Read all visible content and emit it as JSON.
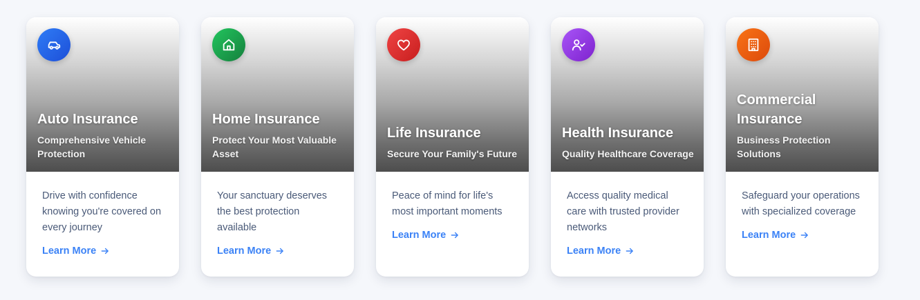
{
  "cards": [
    {
      "title": "Auto Insurance",
      "subtitle": "Comprehensive Vehicle Protection",
      "description": "Drive with confidence knowing you're covered on every journey",
      "link": "Learn More",
      "icon": "car-icon",
      "color_from": "#2f7cf6",
      "color_to": "#1d4fd8"
    },
    {
      "title": "Home Insurance",
      "subtitle": "Protect Your Most Valuable Asset",
      "description": "Your sanctuary deserves the best protection available",
      "link": "Learn More",
      "icon": "home-icon",
      "color_from": "#22c55e",
      "color_to": "#15803d"
    },
    {
      "title": "Life Insurance",
      "subtitle": "Secure Your Family's Future",
      "description": "Peace of mind for life's most important moments",
      "link": "Learn More",
      "icon": "heart-icon",
      "color_from": "#ef4444",
      "color_to": "#c81e1e"
    },
    {
      "title": "Health Insurance",
      "subtitle": "Quality Healthcare Coverage",
      "description": "Access quality medical care with trusted provider networks",
      "link": "Learn More",
      "icon": "user-check-icon",
      "color_from": "#a855f7",
      "color_to": "#7e22ce"
    },
    {
      "title": "Commercial Insurance",
      "subtitle": "Business Protection Solutions",
      "description": "Safeguard your operations with specialized coverage",
      "link": "Learn More",
      "icon": "building-icon",
      "color_from": "#f97316",
      "color_to": "#dc4a0c"
    }
  ]
}
